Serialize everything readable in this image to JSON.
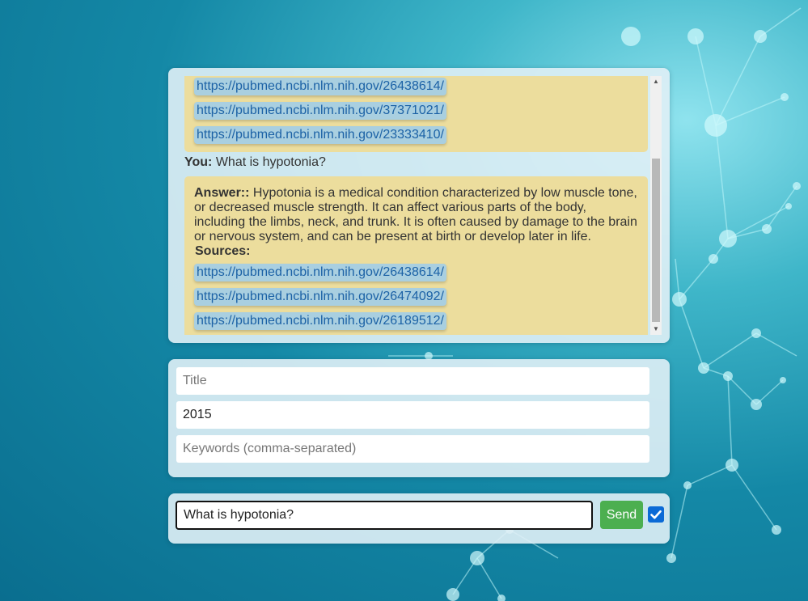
{
  "colors": {
    "accent_send": "#4caf50",
    "answer_bg": "#ecdd9d",
    "link_bg": "#a9cfe0",
    "link_text": "#1c62a6",
    "checkbox": "#0b6ad6"
  },
  "chat": {
    "previous_sources": [
      "https://pubmed.ncbi.nlm.nih.gov/26438614/",
      "https://pubmed.ncbi.nlm.nih.gov/37371021/",
      "https://pubmed.ncbi.nlm.nih.gov/23333410/"
    ],
    "you_label": "You:",
    "you_question": "What is hypotonia?",
    "answer_label": "Answer::",
    "answer_text": "Hypotonia is a medical condition characterized by low muscle tone, or decreased muscle strength. It can affect various parts of the body, including the limbs, neck, and trunk. It is often caused by damage to the brain or nervous system, and can be present at birth or develop later in life.",
    "sources_label": "Sources:",
    "sources": [
      "https://pubmed.ncbi.nlm.nih.gov/26438614/",
      "https://pubmed.ncbi.nlm.nih.gov/26474092/",
      "https://pubmed.ncbi.nlm.nih.gov/26189512/"
    ]
  },
  "filters": {
    "title_placeholder": "Title",
    "title_value": "",
    "year_value": "2015",
    "keywords_placeholder": "Keywords (comma-separated)",
    "keywords_value": ""
  },
  "input": {
    "question_value": "What is hypotonia?",
    "send_label": "Send",
    "checkbox_checked": true
  }
}
